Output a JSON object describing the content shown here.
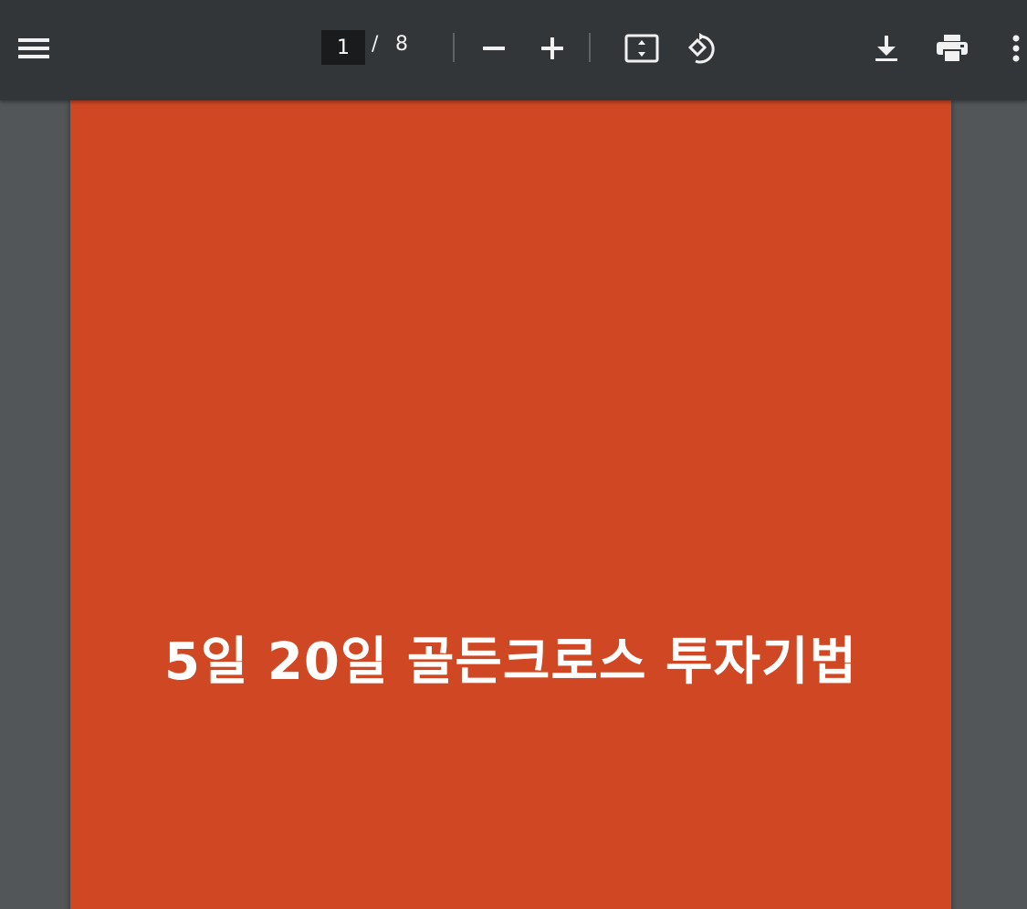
{
  "toolbar": {
    "menu_icon": "hamburger-menu-icon",
    "current_page": "1",
    "page_separator": "/",
    "total_pages": "8",
    "zoom_out_icon": "minus-icon",
    "zoom_in_icon": "plus-icon",
    "fit_icon": "fit-to-page-icon",
    "rotate_icon": "rotate-icon",
    "download_icon": "download-icon",
    "print_icon": "print-icon",
    "more_icon": "more-vertical-icon"
  },
  "document": {
    "page_color": "#d04723",
    "title": "5일 20일 골든크로스 투자기법"
  },
  "colors": {
    "toolbar_bg": "#323639",
    "viewer_bg": "#525659",
    "page_input_bg": "#191b1c",
    "icon_color": "#f1f1f1"
  }
}
